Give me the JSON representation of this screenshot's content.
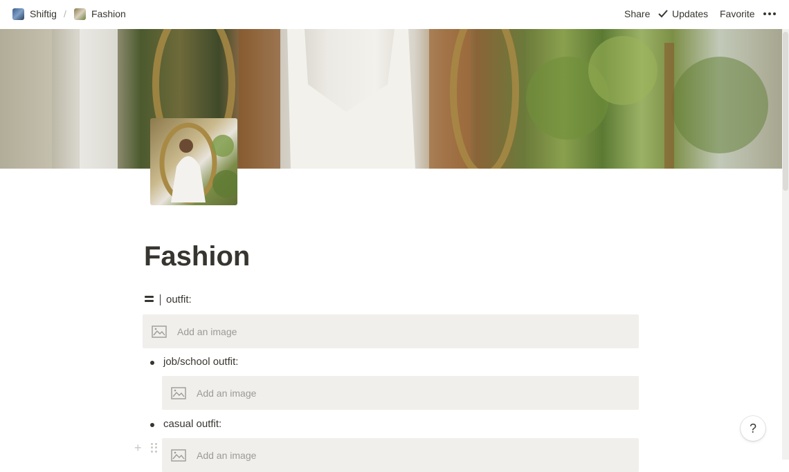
{
  "breadcrumb": {
    "workspace": "Shiftig",
    "separator": "/",
    "page": "Fashion"
  },
  "topbar": {
    "share": "Share",
    "updates": "Updates",
    "favorite": "Favorite",
    "more_icon": "more-dots-icon"
  },
  "page": {
    "title": "Fashion"
  },
  "blocks": {
    "outfit_heading": "outfit:",
    "add_image": "Add an image",
    "bullets": [
      "job/school outfit:",
      "casual outfit:"
    ]
  },
  "help": "?",
  "colors": {
    "text": "#37352f",
    "block_bg": "#f0efeb",
    "placeholder": "#9b9a97"
  }
}
